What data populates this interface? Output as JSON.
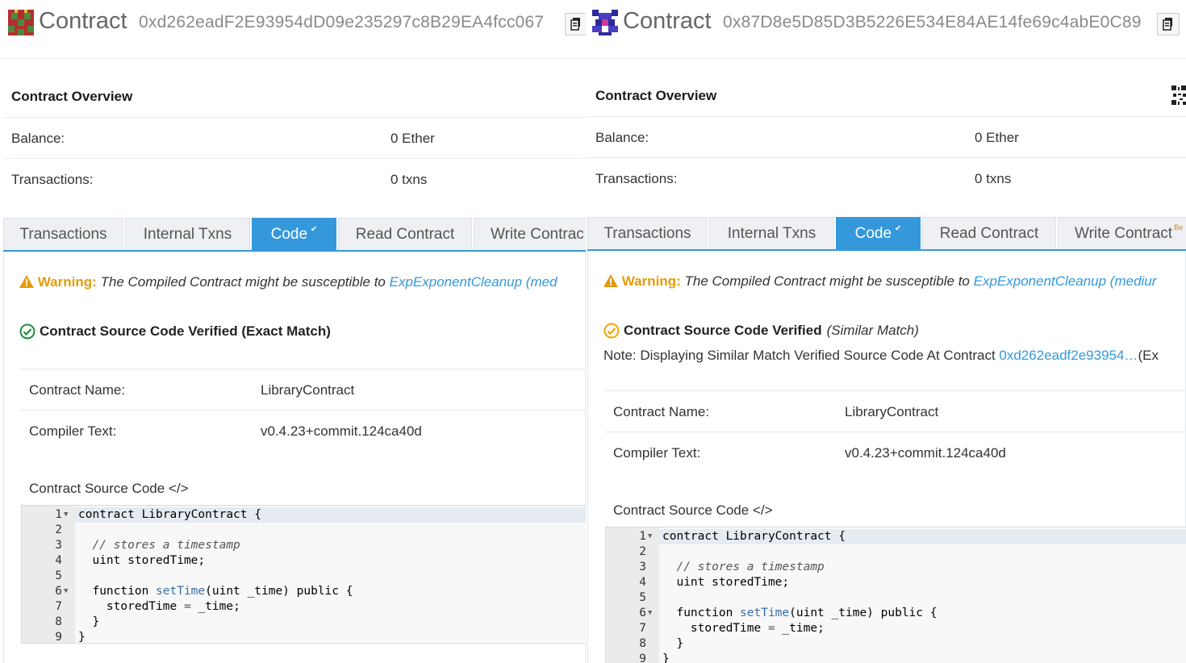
{
  "left": {
    "header": {
      "title": "Contract",
      "address": "0xd262eadF2E93954dD09e235297c8B29EA4fcc067"
    },
    "overview": {
      "title": "Contract Overview",
      "balance_label": "Balance:",
      "balance_value": "0 Ether",
      "txns_label": "Transactions:",
      "txns_value": "0 txns"
    },
    "tabs": [
      "Transactions",
      "Internal Txns",
      "Code",
      "Read Contract",
      "Write Contrac"
    ],
    "warning": {
      "label": "Warning:",
      "text": " The Compiled Contract might be susceptible to ",
      "link": "ExpExponentCleanup (med"
    },
    "verified": {
      "text": "Contract Source Code Verified (Exact Match)"
    },
    "info": {
      "name_label": "Contract Name:",
      "name_value": "LibraryContract",
      "compiler_label": "Compiler Text:",
      "compiler_value": "v0.4.23+commit.124ca40d"
    },
    "source_label": "Contract Source Code </>"
  },
  "right": {
    "header": {
      "title": "Contract",
      "address": "0x87D8e5D85D3B5226E534E84AE14fe69c4abE0C89"
    },
    "overview": {
      "title": "Contract Overview",
      "balance_label": "Balance:",
      "balance_value": "0 Ether",
      "txns_label": "Transactions:",
      "txns_value": "0 txns"
    },
    "tabs": [
      "Transactions",
      "Internal Txns",
      "Code",
      "Read Contract",
      "Write Contract"
    ],
    "tab_sup": "Be",
    "warning": {
      "label": "Warning:",
      "text": " The Compiled Contract might be susceptible to ",
      "link": "ExpExponentCleanup (mediur"
    },
    "verified": {
      "text": "Contract Source Code Verified",
      "match": "(Similar Match)"
    },
    "note": {
      "text": "Note: Displaying Similar Match Verified Source Code At Contract ",
      "link": "0xd262eadf2e93954…",
      "suffix": "(Ex"
    },
    "info": {
      "name_label": "Contract Name:",
      "name_value": "LibraryContract",
      "compiler_label": "Compiler Text:",
      "compiler_value": "v0.4.23+commit.124ca40d"
    },
    "source_label": "Contract Source Code </>"
  },
  "code": {
    "line_numbers": [
      "1",
      "2",
      "3",
      "4",
      "5",
      "6",
      "7",
      "8",
      "9"
    ],
    "lines": [
      "contract LibraryContract {",
      "",
      "  // stores a timestamp",
      "  uint storedTime;",
      "",
      "  function setTime(uint _time) public {",
      "    storedTime = _time;",
      "  }",
      "}"
    ]
  },
  "colors": {
    "accent": "#3498db",
    "warning": "#e39b09",
    "verified_green": "#1e8e3e",
    "similar_orange": "#f0a500"
  },
  "icons": [
    "identicon-red-green",
    "identicon-purple",
    "copy-icon",
    "qr-code-icon",
    "check-circle-icon",
    "warning-triangle-icon"
  ]
}
